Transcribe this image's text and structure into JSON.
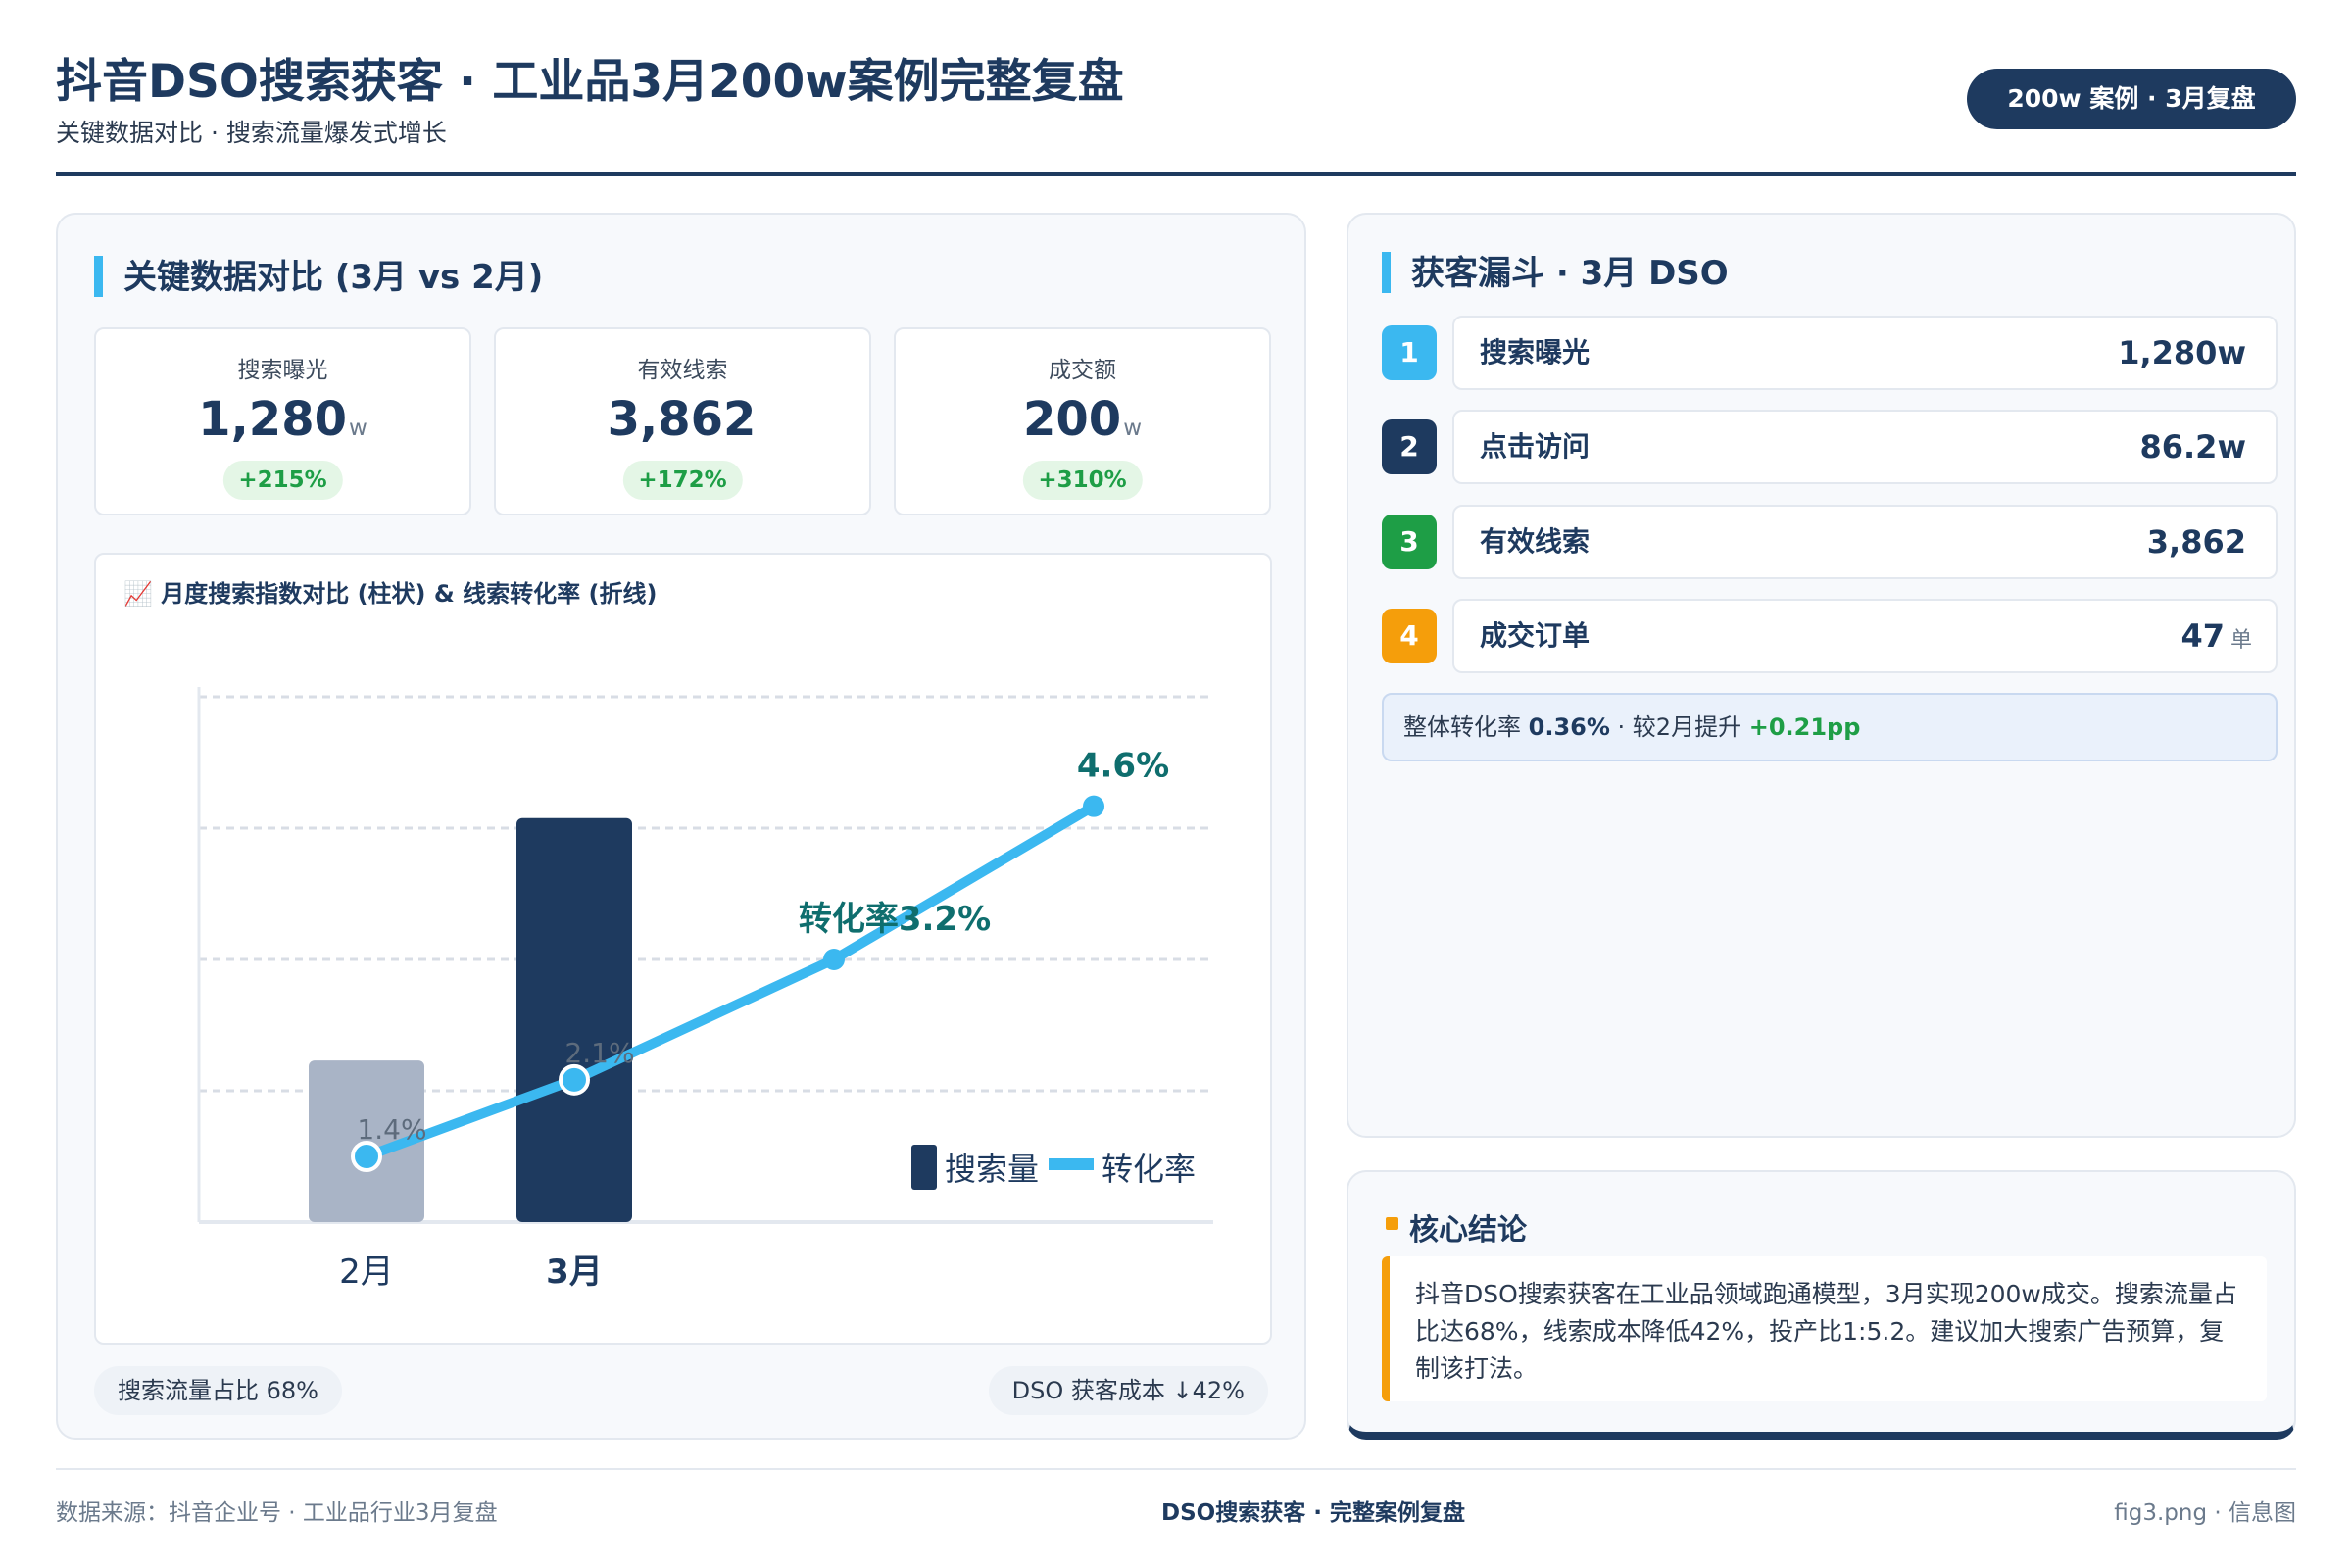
{
  "header": {
    "title": "抖音DSO搜索获客 · 工业品3月200w案例完整复盘",
    "subtitle": "关键数据对比 · 搜索流量爆发式增长",
    "badge": "200w 案例 · 3月复盘"
  },
  "left_panel": {
    "title": "关键数据对比 (3月 vs 2月)",
    "kpis": [
      {
        "label": "搜索曝光",
        "value": "1,280",
        "unit": "w",
        "delta": "+215%"
      },
      {
        "label": "有效线索",
        "value": "3,862",
        "unit": "",
        "delta": "+172%"
      },
      {
        "label": "成交额",
        "value": "200",
        "unit": "w",
        "delta": "+310%"
      }
    ],
    "chart_title": "📈 月度搜索指数对比 (柱状) & 线索转化率 (折线)",
    "footer_left": "搜索流量占比 68%",
    "footer_right": "DSO 获客成本 ↓42%"
  },
  "chart_data": {
    "type": "bar",
    "title": "📈 月度搜索指数对比 (柱状) & 线索转化率 (折线)",
    "categories": [
      "2月",
      "3月"
    ],
    "series": [
      {
        "name": "搜索量",
        "type": "bar",
        "values": [
          40,
          100
        ]
      },
      {
        "name": "转化率",
        "type": "line",
        "points": [
          {
            "x": 0,
            "y": 1.4,
            "label": "1.4%"
          },
          {
            "x": 1,
            "y": 2.1,
            "label": "2.1%"
          },
          {
            "x": 2.25,
            "y": 3.2,
            "label": "转化率3.2%"
          },
          {
            "x": 3.5,
            "y": 4.6,
            "label": "4.6%"
          }
        ]
      }
    ],
    "bar_ylim": [
      0,
      130
    ],
    "line_ylim": [
      0.8,
      5.6
    ],
    "grid": true,
    "legend": "bottom-right",
    "colors": {
      "feb_bar": "#a9b4c6",
      "mar_bar": "#1e3a5f",
      "line": "#3bb8f0",
      "label": "#0f6e6e",
      "grid": "#d8dde5"
    }
  },
  "right_panel": {
    "title": "获客漏斗 · 3月 DSO",
    "funnel": [
      {
        "num": "1",
        "label": "搜索曝光",
        "value": "1,280w",
        "unit": "",
        "color": "#3bb8f0"
      },
      {
        "num": "2",
        "label": "点击访问",
        "value": "86.2w",
        "unit": "",
        "color": "#1e3a5f"
      },
      {
        "num": "3",
        "label": "有效线索",
        "value": "3,862",
        "unit": "",
        "color": "#1e9e46"
      },
      {
        "num": "4",
        "label": "成交订单",
        "value": "47",
        "unit": "单",
        "color": "#f59e0b"
      }
    ],
    "summary": {
      "prefix": "整体转化率",
      "rate": "0.36%",
      "mid": "· 较2月提升",
      "lift": "+0.21pp"
    }
  },
  "conclusion": {
    "title": "核心结论",
    "body": "抖音DSO搜索获客在工业品领域跑通模型，3月实现200w成交。搜索流量占比达68%，线索成本降低42%，投产比1:5.2。建议加大搜索广告预算，复制该打法。"
  },
  "footer": {
    "left": "数据来源：抖音企业号 · 工业品行业3月复盘",
    "center": "DSO搜索获客 · 完整案例复盘",
    "right": "fig3.png · 信息图"
  }
}
